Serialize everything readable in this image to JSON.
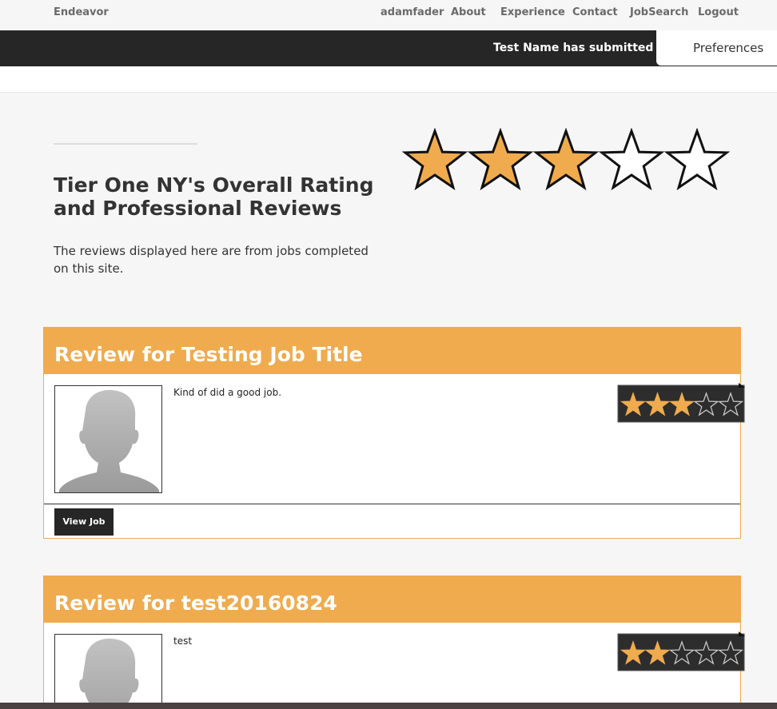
{
  "nav": {
    "brand": "Endeavor",
    "user": "adamfader",
    "about": "About",
    "experience": "Experience",
    "contact": "Contact",
    "jobsearch": "JobSearch",
    "logout": "Logout"
  },
  "ticker": {
    "text": "Test Name has submitted a bi"
  },
  "preferences": {
    "label": "Preferences"
  },
  "header": {
    "title": "Tier One NY's Overall Rating and Professional Reviews",
    "intro": "The reviews displayed here are from jobs completed on this site.",
    "overall_rating": 3,
    "max_rating": 5
  },
  "reviews": [
    {
      "title": "Review for Testing Job Title",
      "text": "Kind of did a good job.",
      "rating": 3,
      "button_label": "View Job"
    },
    {
      "title": "Review for test20160824",
      "text": "test",
      "rating": 2
    }
  ],
  "colors": {
    "accent": "#efab4d",
    "dark": "#262626",
    "star_fill": "#efab4d"
  }
}
